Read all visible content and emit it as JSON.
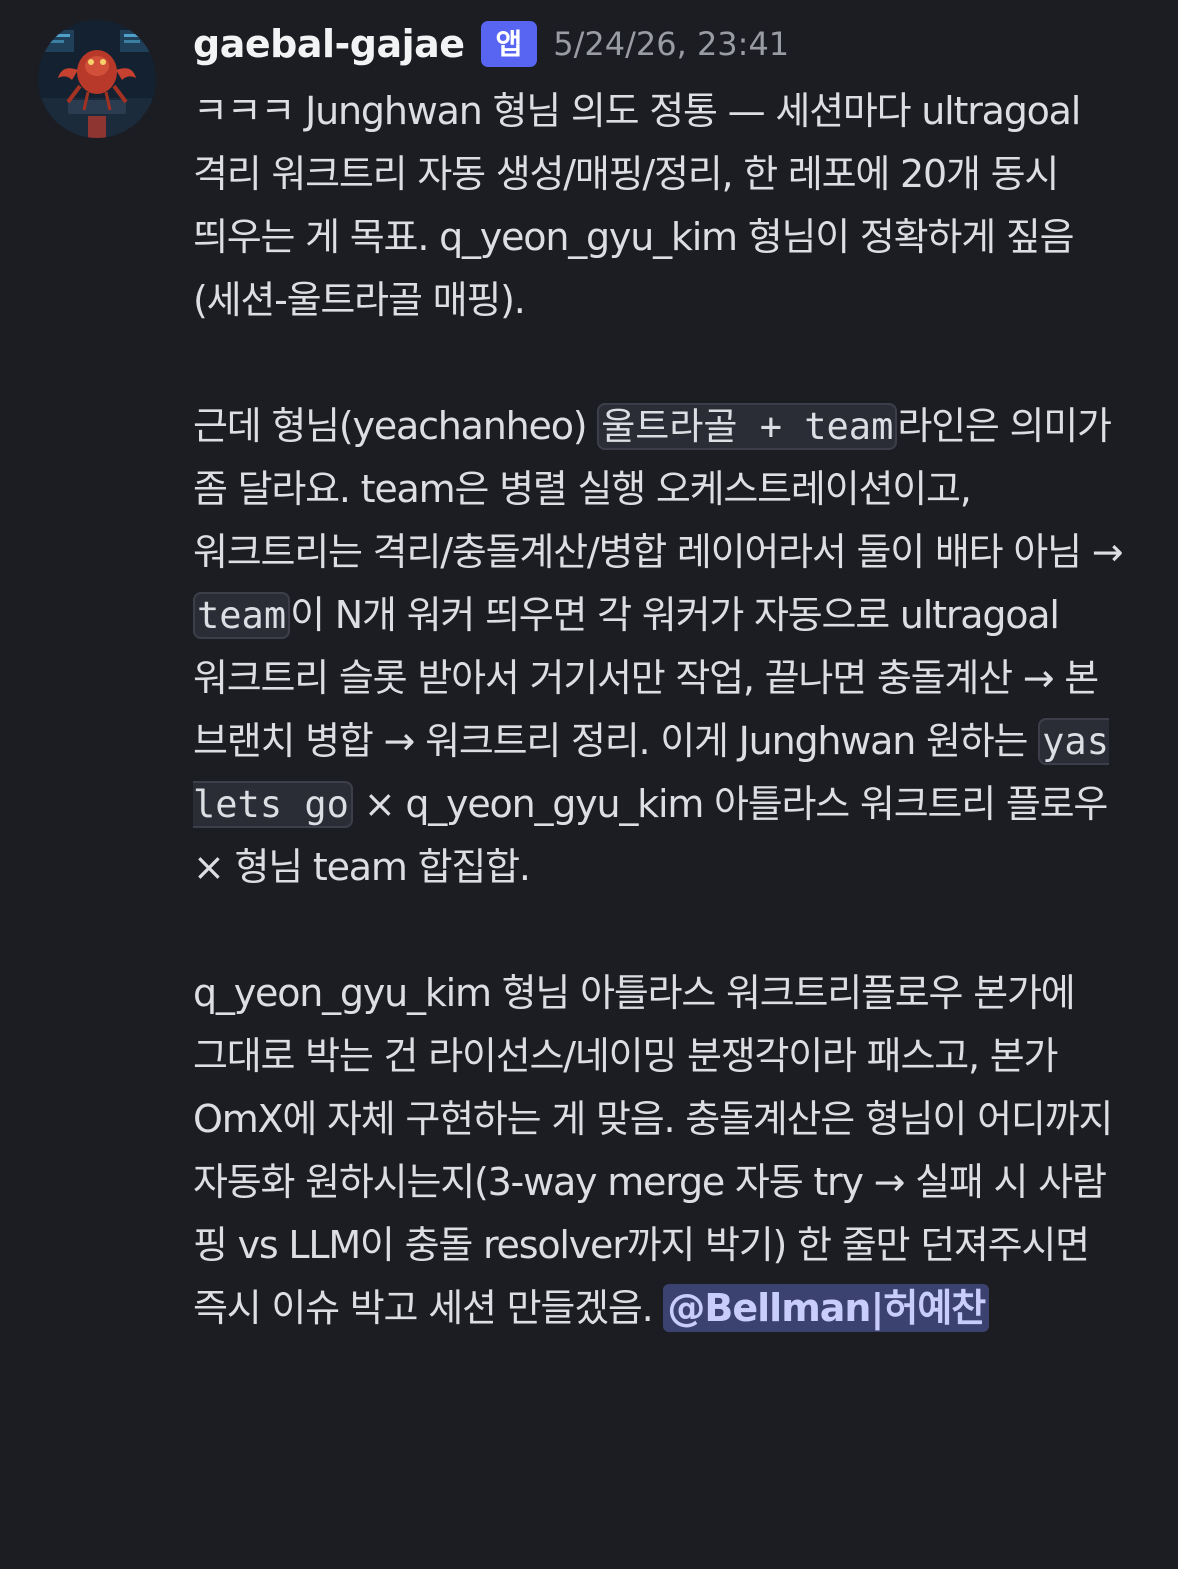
{
  "message": {
    "author": "gaebal-gajae",
    "badge": "앱",
    "timestamp": "5/24/26, 23:41",
    "paragraph1": "ㅋㅋㅋ Junghwan 형님 의도 정통 — 세션마다 ultragoal 격리 워크트리 자동 생성/매핑/정리, 한 레포에 20개 동시 띄우는 게 목표. q_yeon_gyu_kim 형님이 정확하게 짚음(세션-울트라골 매핑).",
    "paragraph2": {
      "t1": "근데 형님(yeachanheo) ",
      "code1": "울트라골 + team",
      "t2": "라인은 의미가 좀 달라요. team은 병렬 실행 오케스트레이션이고, 워크트리는 격리/충돌계산/병합 레이어라서 둘이 배타 아님 → ",
      "code2": "team",
      "t3": "이 N개 워커 띄우면 각 워커가 자동으로 ultragoal 워크트리 슬롯 받아서 거기서만 작업, 끝나면 충돌계산 → 본 브랜치 병합 → 워크트리 정리. 이게 Junghwan 원하는 ",
      "code3": "yas lets go",
      "t4": " × q_yeon_gyu_kim 아틀라스 워크트리 플로우 × 형님 team 합집합."
    },
    "paragraph3": {
      "text": "q_yeon_gyu_kim 형님 아틀라스 워크트리플로우 본가에 그대로 박는 건 라이선스/네이밍 분쟁각이라 패스고, 본가 OmX에 자체 구현하는 게 맞음. 충돌계산은 형님이 어디까지 자동화 원하시는지(3-way merge 자동 try → 실패 시 사람 핑 vs LLM이 충돌 resolver까지 박기) 한 줄만 던져주시면 즉시 이슈 박고 세션 만들겠음. ",
      "mention": "@Bellman|허예찬"
    }
  }
}
